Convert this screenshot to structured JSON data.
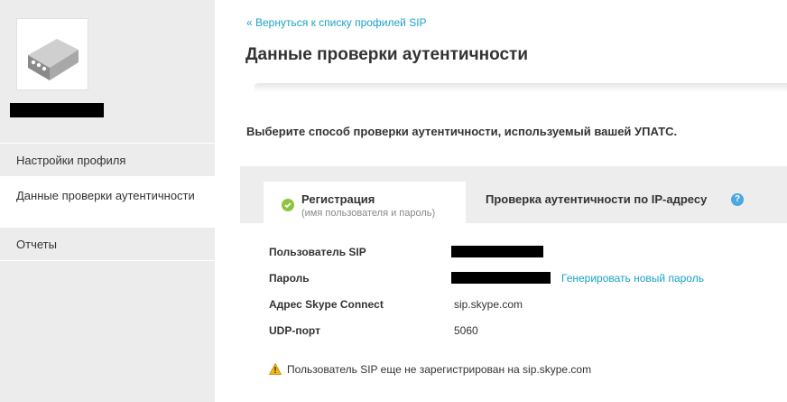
{
  "sidebar": {
    "device_icon": "sip-device-icon",
    "nav": [
      {
        "label": "Настройки профиля"
      },
      {
        "label": "Данные проверки аутентичности"
      },
      {
        "label": "Отчеты"
      }
    ]
  },
  "main": {
    "back_link": "« Вернуться к списку профилей SIP",
    "title": "Данные проверки аутентичности",
    "instruction": "Выберите способ проверки аутентичности, используемый вашей УПАТС.",
    "tabs": {
      "registration": {
        "title": "Регистрация",
        "subtitle": "(имя пользователя и пароль)",
        "icon": "check-circle-icon"
      },
      "ip": {
        "title": "Проверка аутентичности по IP-адресу",
        "icon": "help-icon"
      }
    },
    "fields": {
      "sip_user_label": "Пользователь SIP",
      "password_label": "Пароль",
      "generate_password": "Генерировать новый пароль",
      "address_label": "Адрес Skype Connect",
      "address_value": "sip.skype.com",
      "udp_label": "UDP-порт",
      "udp_value": "5060"
    },
    "warning": {
      "icon": "warning-icon",
      "text": "Пользователь SIP еще не зарегистрирован на sip.skype.com"
    }
  },
  "colors": {
    "link": "#1aa3c7",
    "sidebar_bg": "#ececec",
    "check": "#8bc53f",
    "help": "#4aa8e0"
  }
}
